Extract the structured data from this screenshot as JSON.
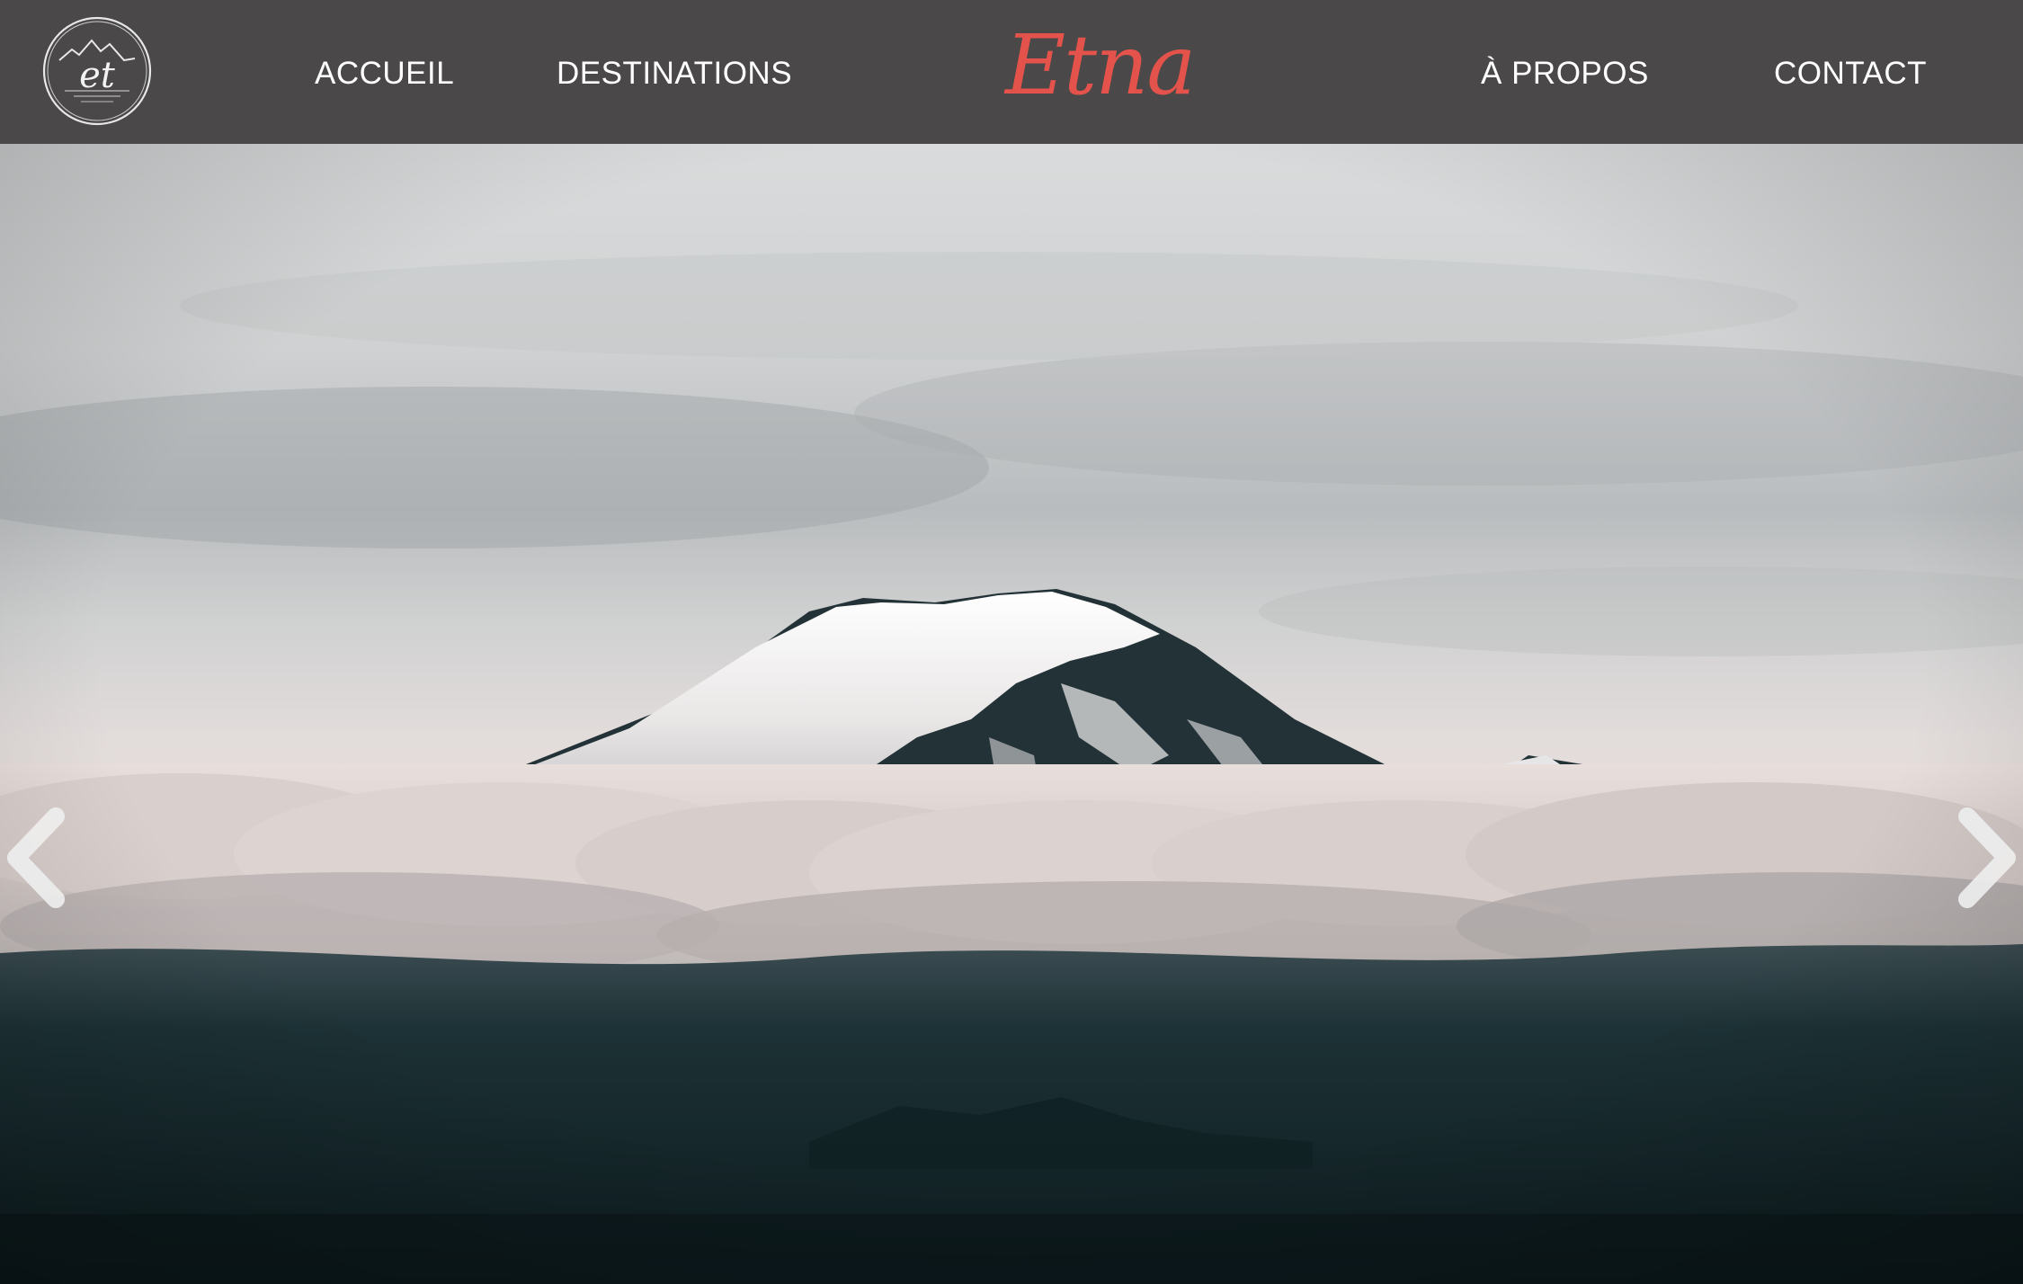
{
  "nav": {
    "logo_text": "et",
    "links": [
      {
        "label": "ACCUEIL"
      },
      {
        "label": "DESTINATIONS"
      },
      {
        "label": "À PROPOS"
      },
      {
        "label": "CONTACT"
      }
    ],
    "brand": "Etna"
  },
  "hero": {
    "image_subject": "snow-capped-volcano-above-clouds",
    "prev_icon": "chevron-left-icon",
    "next_icon": "chevron-right-icon"
  },
  "colors": {
    "navbar_bg": "#4a4848",
    "brand_accent": "#e4534b",
    "nav_text": "#ffffff"
  }
}
